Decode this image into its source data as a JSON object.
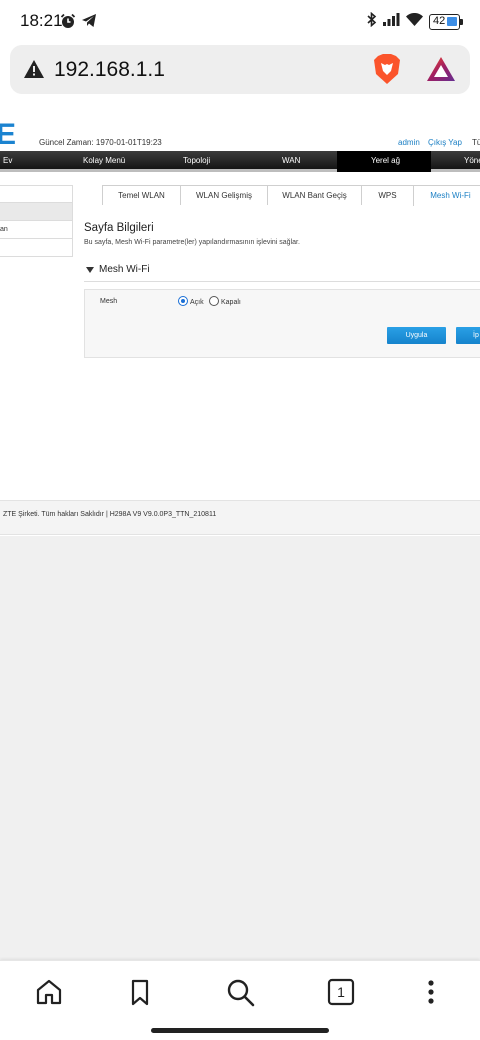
{
  "status_bar": {
    "time": "18:21",
    "battery": "42"
  },
  "browser": {
    "url": "192.168.1.1"
  },
  "header": {
    "logo": "E",
    "current_time": "Güncel Zaman: 1970-01-01T19:23",
    "user": "admin",
    "logout": "Çıkış Yap",
    "language": "Tü"
  },
  "nav": {
    "items": [
      "Ev",
      "Kolay Menü",
      "Topoloji",
      "WAN",
      "Yerel ağ",
      "Yöne"
    ],
    "active": "Yerel ağ"
  },
  "sidebar": {
    "items": [
      "",
      "",
      "an",
      ""
    ]
  },
  "tabs": {
    "items": [
      "Temel WLAN",
      "WLAN Gelişmiş",
      "WLAN Bant Geçiş",
      "WPS",
      "Mesh Wi-Fi"
    ],
    "active": "Mesh Wi-Fi"
  },
  "page_info": {
    "title": "Sayfa Bilgileri",
    "description": "Bu sayfa, Mesh Wi-Fi parametre(ler) yapılandırmasının işlevini sağlar."
  },
  "section": {
    "title": "Mesh Wi-Fi"
  },
  "mesh": {
    "label": "Mesh",
    "options": [
      "Açık",
      "Kapalı"
    ],
    "selected": "Açık",
    "apply_button": "Uygula",
    "cancel_button": "İp"
  },
  "footer": {
    "text": "ZTE Şirketi. Tüm hakları Saklıdır  |   H298A V9 V9.0.0P3_TTN_210811"
  },
  "bottom_nav": {
    "tab_count": "1"
  },
  "colors": {
    "accent": "#1b83d0",
    "nav_bg": "#1e1e1e",
    "button": "#1a8ad6"
  }
}
